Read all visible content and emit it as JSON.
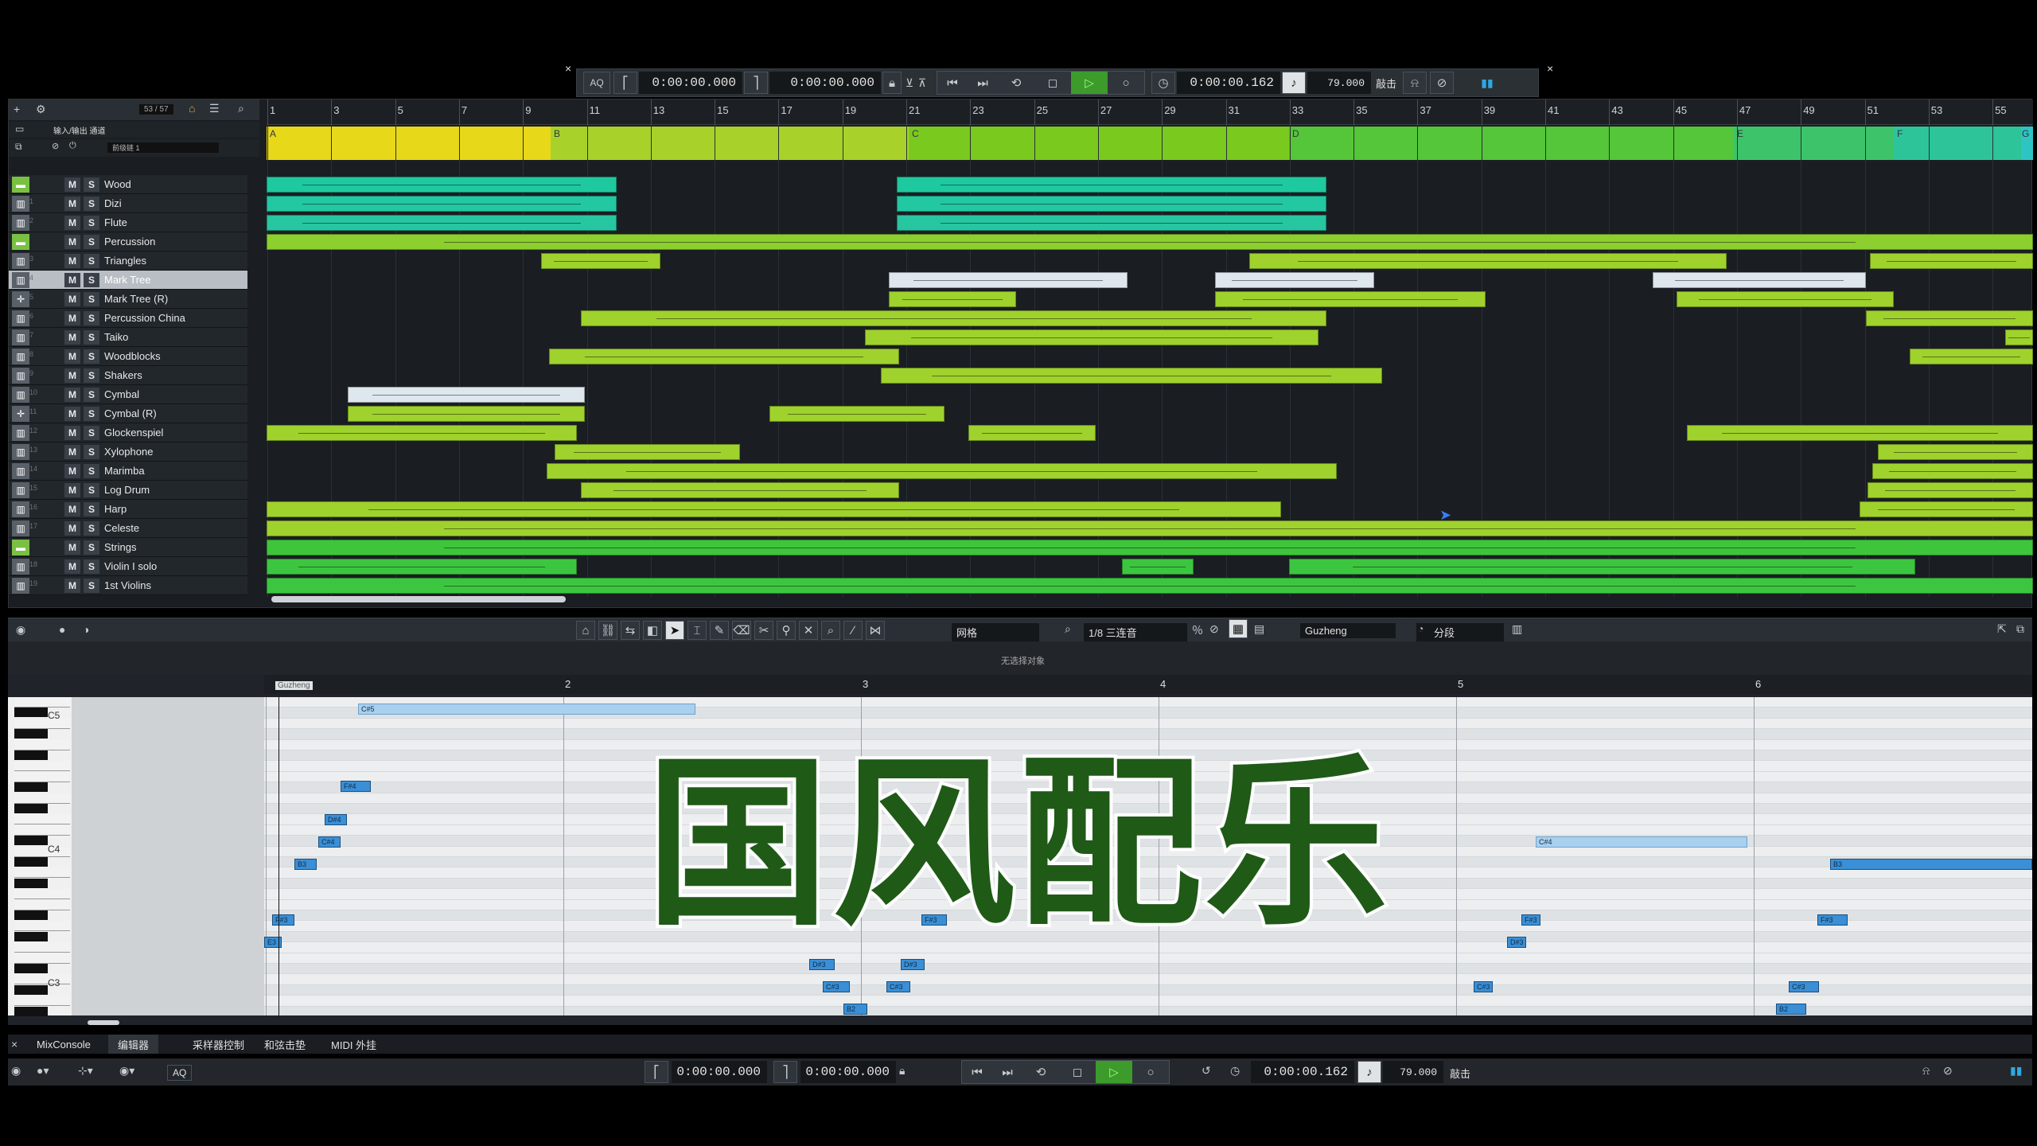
{
  "transport": {
    "top": {
      "aq": "AQ",
      "left_locator": "0:00:00.000",
      "right_locator": "0:00:00.000",
      "position": "0:00:00.162",
      "tempo": "79.000",
      "tempo_mode": "敲击"
    },
    "bottom": {
      "aq": "AQ",
      "left_locator": "0:00:00.000",
      "right_locator": "0:00:00.000",
      "position": "0:00:00.162",
      "tempo": "79.000",
      "tempo_mode": "敲击"
    }
  },
  "inspector": {
    "counter": "53 / 57",
    "io_label": "输入/输出 通道",
    "pre_label": "前级链 1"
  },
  "ruler": {
    "bars": [
      "1",
      "3",
      "5",
      "7",
      "9",
      "11",
      "13",
      "15",
      "17",
      "19",
      "21",
      "23",
      "25",
      "27",
      "29",
      "31",
      "33",
      "35",
      "37",
      "39",
      "41",
      "43",
      "45",
      "47",
      "49",
      "51",
      "53",
      "55"
    ]
  },
  "markers": [
    "A",
    "B",
    "C",
    "D",
    "E",
    "F",
    "G"
  ],
  "tracks": [
    {
      "name": "Wood",
      "type": "folder",
      "n": ""
    },
    {
      "name": "Dizi",
      "type": "midi",
      "n": "1"
    },
    {
      "name": "Flute",
      "type": "midi",
      "n": "2"
    },
    {
      "name": "Percussion",
      "type": "folder",
      "n": ""
    },
    {
      "name": "Triangles",
      "type": "midi",
      "n": "3"
    },
    {
      "name": "Mark Tree",
      "type": "midi",
      "n": "4",
      "selected": true
    },
    {
      "name": "Mark Tree (R)",
      "type": "audio",
      "n": "5"
    },
    {
      "name": "Percussion China",
      "type": "midi",
      "n": "6"
    },
    {
      "name": "Taiko",
      "type": "midi",
      "n": "7"
    },
    {
      "name": "Woodblocks",
      "type": "midi",
      "n": "8"
    },
    {
      "name": "Shakers",
      "type": "midi",
      "n": "9"
    },
    {
      "name": "Cymbal",
      "type": "midi",
      "n": "10"
    },
    {
      "name": "Cymbal (R)",
      "type": "audio",
      "n": "11"
    },
    {
      "name": "Glockenspiel",
      "type": "midi",
      "n": "12"
    },
    {
      "name": "Xylophone",
      "type": "midi",
      "n": "13"
    },
    {
      "name": "Marimba",
      "type": "midi",
      "n": "14"
    },
    {
      "name": "Log Drum",
      "type": "midi",
      "n": "15"
    },
    {
      "name": "Harp",
      "type": "midi",
      "n": "16"
    },
    {
      "name": "Celeste",
      "type": "midi",
      "n": "17"
    },
    {
      "name": "Strings",
      "type": "folder",
      "n": ""
    },
    {
      "name": "Violin I solo",
      "type": "midi",
      "n": "18"
    },
    {
      "name": "1st Violins",
      "type": "midi",
      "n": "19"
    }
  ],
  "editor": {
    "grid_label": "网格",
    "quantize": "1/8 三连音",
    "instrument": "Guzheng",
    "segment": "分段",
    "status": "无选择对象",
    "part_name": "Guzheng",
    "bars": [
      "2",
      "3",
      "4",
      "5",
      "6"
    ],
    "keys": [
      "C5",
      "C4",
      "C3"
    ],
    "notes": [
      "C#5",
      "F#4",
      "D#4",
      "C#4",
      "B3",
      "F#3",
      "E3",
      "D#3",
      "C#3",
      "B2",
      "F#3",
      "D#3",
      "C#3",
      "C#4",
      "F#3",
      "D#3",
      "C#3",
      "B3",
      "F#3",
      "C#3",
      "B2"
    ]
  },
  "overlay_title": "国风配乐",
  "bottom_tabs": [
    "MixConsole",
    "编辑器",
    "采样器控制",
    "和弦击垫",
    "MIDI 外挂"
  ],
  "colors": {
    "accent_green": "#7ac143",
    "title_green": "#1f5a17",
    "note_blue": "#3a8fd6"
  }
}
